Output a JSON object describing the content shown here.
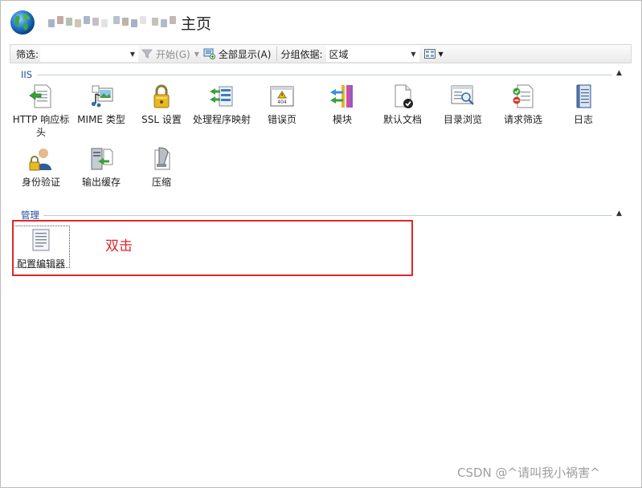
{
  "header": {
    "title": "主页",
    "blurred_name_colors": [
      "#a9b3c3",
      "#c7a9a4",
      "#b4c0b2",
      "#d0c4b3",
      "#a8b6cc",
      "#c6bec6",
      "#e2e2e2",
      "#b6c2cf",
      "#bfb2a6",
      "#a6b2c4",
      "#e4e4e4",
      "#c8c0b6",
      "#b2bcc8",
      "#c2b9b1"
    ]
  },
  "toolbar": {
    "filter_label": "筛选:",
    "filter_value": "",
    "start_label": "开始(G)",
    "show_all_label": "全部显示(A)",
    "group_by_label": "分组依据:",
    "group_by_value": "区域"
  },
  "groups": [
    {
      "title": "IIS",
      "items": [
        {
          "label": "HTTP 响应标头",
          "icon": "http-response-headers-icon"
        },
        {
          "label": "MIME 类型",
          "icon": "mime-types-icon"
        },
        {
          "label": "SSL 设置",
          "icon": "ssl-lock-icon"
        },
        {
          "label": "处理程序映射",
          "icon": "handler-mappings-icon"
        },
        {
          "label": "错误页",
          "icon": "error-pages-icon"
        },
        {
          "label": "模块",
          "icon": "modules-icon"
        },
        {
          "label": "默认文档",
          "icon": "default-document-icon"
        },
        {
          "label": "目录浏览",
          "icon": "directory-browsing-icon"
        },
        {
          "label": "请求筛选",
          "icon": "request-filtering-icon"
        },
        {
          "label": "日志",
          "icon": "logging-icon"
        },
        {
          "label": "身份验证",
          "icon": "authentication-icon"
        },
        {
          "label": "输出缓存",
          "icon": "output-caching-icon"
        },
        {
          "label": "压缩",
          "icon": "compression-icon"
        }
      ]
    },
    {
      "title": "管理",
      "items": [
        {
          "label": "配置编辑器",
          "icon": "configuration-editor-icon"
        }
      ]
    }
  ],
  "annotation": "双击",
  "watermark": "CSDN @^请叫我小祸害^",
  "colors": {
    "accent_blue": "#1c4aa0",
    "annotation_red": "#e0262a"
  }
}
